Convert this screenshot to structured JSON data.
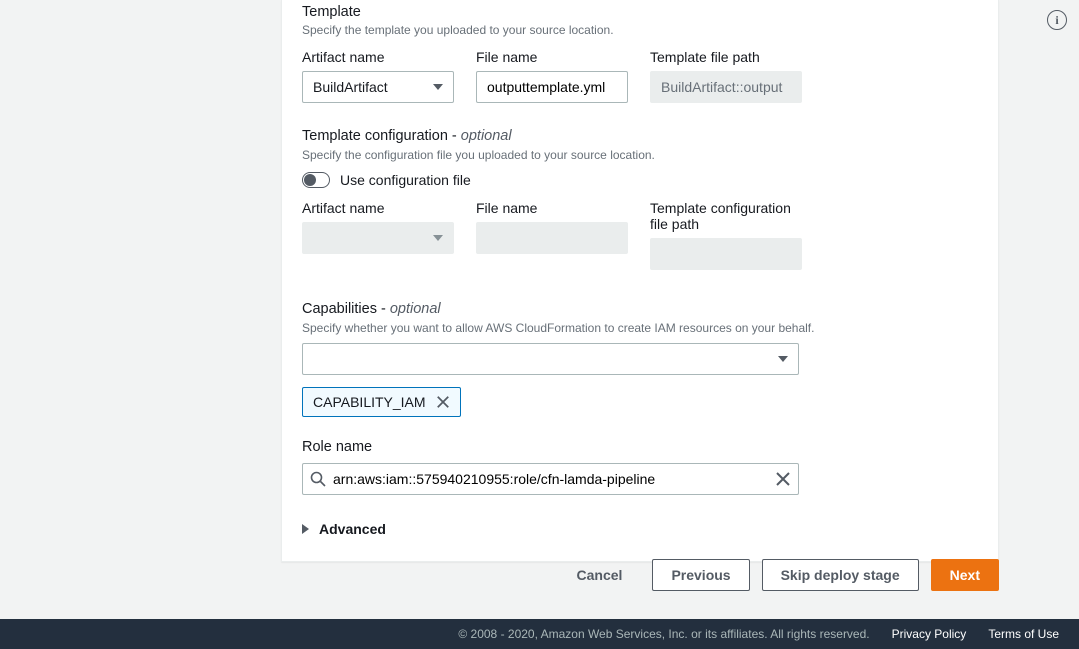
{
  "template": {
    "title": "Template",
    "desc": "Specify the template you uploaded to your source location.",
    "artifact": {
      "label": "Artifact name",
      "value": "BuildArtifact"
    },
    "file": {
      "label": "File name",
      "value": "outputtemplate.yml"
    },
    "path": {
      "label": "Template file path",
      "value": "BuildArtifact::output"
    }
  },
  "config": {
    "title": "Template configuration - ",
    "optional": "optional",
    "desc": "Specify the configuration file you uploaded to your source location.",
    "toggle_label": "Use configuration file",
    "toggle_on": false,
    "artifact": {
      "label": "Artifact name",
      "value": ""
    },
    "file": {
      "label": "File name",
      "value": ""
    },
    "path": {
      "label": "Template configuration file path",
      "value": ""
    }
  },
  "capabilities": {
    "title": "Capabilities - ",
    "optional": "optional",
    "desc": "Specify whether you want to allow AWS CloudFormation to create IAM resources on your behalf.",
    "selected": "",
    "tokens": [
      "CAPABILITY_IAM"
    ]
  },
  "role": {
    "label": "Role name",
    "value": "arn:aws:iam::575940210955:role/cfn-lamda-pipeline"
  },
  "advanced": {
    "label": "Advanced"
  },
  "buttons": {
    "cancel": "Cancel",
    "previous": "Previous",
    "skip": "Skip deploy stage",
    "next": "Next"
  },
  "footer": {
    "copy": "© 2008 - 2020, Amazon Web Services, Inc. or its affiliates. All rights reserved.",
    "privacy": "Privacy Policy",
    "terms": "Terms of Use"
  }
}
